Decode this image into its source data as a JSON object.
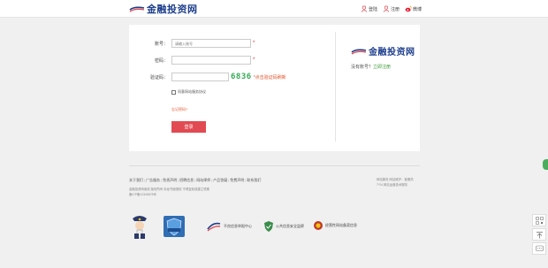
{
  "brand": {
    "name": "金融投资网",
    "color": "#1e3f8c",
    "accent": "#e14a52"
  },
  "header": {
    "links": [
      {
        "label": "登陆",
        "icon": "user-icon"
      },
      {
        "label": "注册",
        "icon": "user-add-icon"
      },
      {
        "label": "微博",
        "icon": "weibo-icon"
      }
    ]
  },
  "form": {
    "account_label": "账号：",
    "account_placeholder": "请输入账号",
    "password_label": "密码：",
    "captcha_label": "验证码：",
    "captcha_code": "6836",
    "captcha_refresh": "*点击验证码刷新",
    "required_mark": "*",
    "agree_text": "同意网站服务协议",
    "forgot_password": "忘记密码?",
    "login_button": "登录"
  },
  "sidebar": {
    "no_account": "没有账号？",
    "register_link": "立即注册"
  },
  "footer": {
    "nav": [
      "关于我们",
      "广告服务",
      "免责声明",
      "招聘信息",
      "网站律师",
      "产品答疑",
      "免费声明",
      "联系我们"
    ],
    "line1": "金融投资网版权 版权所有 未经书面授权 不得复制或建立镜像",
    "line2": "备ICP备12345678号",
    "right_line1": "网站服务 网站维护：客服热",
    "right_line2": "7*24 网站运营技术服务"
  },
  "badges": [
    {
      "label": "",
      "icon": "police-icon"
    },
    {
      "label": "",
      "icon": "security-shield-icon"
    },
    {
      "label": "不良信息举报中心",
      "icon": "report-center-icon"
    },
    {
      "label": "公共信息安全监察",
      "icon": "public-security-icon"
    },
    {
      "label": "经营性网站备案信息",
      "icon": "business-record-icon"
    }
  ],
  "float_bar": [
    {
      "label": "",
      "icon": "qrcode-icon"
    },
    {
      "label": "",
      "icon": "back-to-top-icon"
    },
    {
      "label": "",
      "icon": "feedback-icon"
    }
  ]
}
